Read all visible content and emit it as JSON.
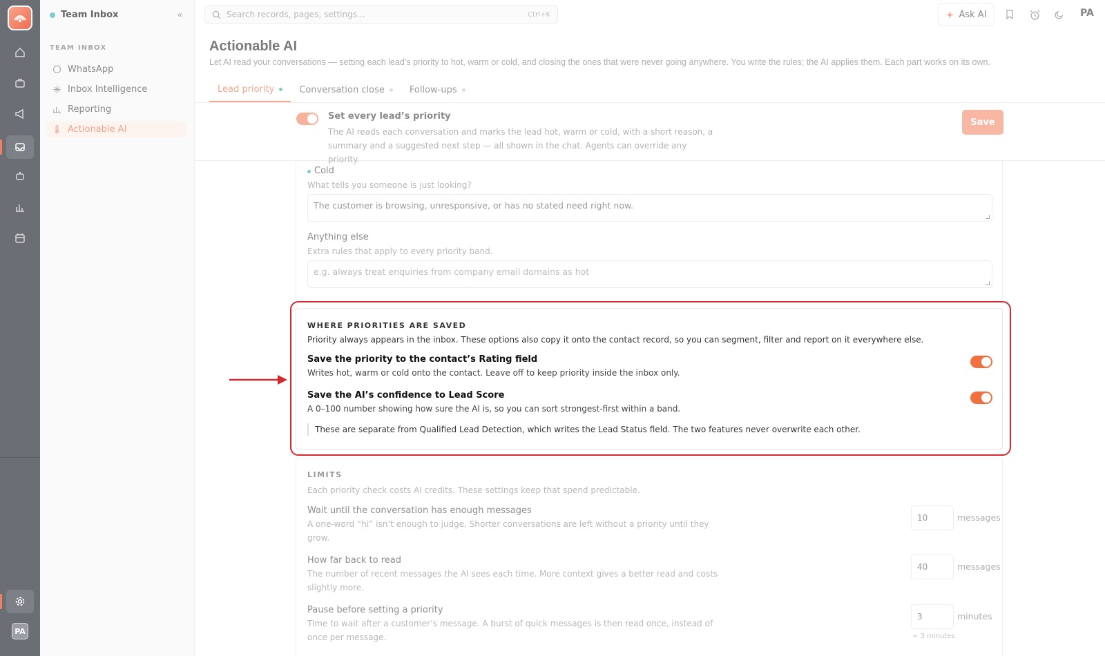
{
  "rail": {
    "avatar": "PA",
    "items": [
      "home-icon",
      "briefcase-icon",
      "megaphone-icon",
      "inbox-icon",
      "bot-icon",
      "chart-icon",
      "calendar-icon"
    ],
    "accent": "#f08060"
  },
  "sidebar": {
    "workspace": "Team Inbox",
    "section": "TEAM INBOX",
    "items": [
      {
        "label": "WhatsApp"
      },
      {
        "label": "Inbox Intelligence"
      },
      {
        "label": "Reporting"
      },
      {
        "label": "Actionable AI"
      }
    ]
  },
  "topbar": {
    "search_placeholder": "Search records, pages, settings...",
    "shortcut": "Ctrl+K",
    "ask_ai": "Ask AI",
    "user": "PA"
  },
  "page": {
    "title": "Actionable AI",
    "subtitle": "Let AI read your conversations — setting each lead’s priority to hot, warm or cold, and closing the ones that were never going anywhere. You write the rules; the AI applies them. Each part works on its own.",
    "tabs": [
      {
        "label": "Lead priority"
      },
      {
        "label": "Conversation close"
      },
      {
        "label": "Follow-ups"
      }
    ]
  },
  "master": {
    "title": "Set every lead’s priority",
    "desc": "The AI reads each conversation and marks the lead hot, warm or cold, with a short reason, a summary and a suggested next step — all shown in the chat. Agents can override any priority.",
    "save": "Save",
    "enabled": true
  },
  "cold": {
    "label": "Cold",
    "help": "What tells you someone is just looking?",
    "value": "The customer is browsing, unresponsive, or has no stated need right now."
  },
  "anything_else": {
    "label": "Anything else",
    "help": "Extra rules that apply to every priority band.",
    "placeholder": "e.g. always treat enquiries from company email domains as hot"
  },
  "saved": {
    "caption": "WHERE PRIORITIES ARE SAVED",
    "desc": "Priority always appears in the inbox. These options also copy it onto the contact record, so you can segment, filter and report on it everywhere else.",
    "rating": {
      "title": "Save the priority to the contact’s Rating field",
      "desc": "Writes hot, warm or cold onto the contact. Leave off to keep priority inside the inbox only.",
      "enabled": true
    },
    "score": {
      "title": "Save the AI’s confidence to Lead Score",
      "desc": "A 0–100 number showing how sure the AI is, so you can sort strongest-first within a band.",
      "enabled": true
    },
    "note": "These are separate from Qualified Lead Detection, which writes the Lead Status field. The two features never overwrite each other."
  },
  "limits": {
    "caption": "LIMITS",
    "desc": "Each priority check costs AI credits. These settings keep that spend predictable.",
    "rows": [
      {
        "title": "Wait until the conversation has enough messages",
        "desc1": "A one-word “hi” isn’t enough to judge. Shorter conversations are left without a priority until they",
        "desc2": "grow.",
        "value": "10",
        "unit": "messages"
      },
      {
        "title": "How far back to read",
        "desc1": "The number of recent messages the AI sees each time. More context gives a better read and costs",
        "desc2": "slightly more.",
        "value": "40",
        "unit": "messages"
      },
      {
        "title": "Pause before setting a priority",
        "desc1": "Time to wait after a customer’s message. A burst of quick messages is then read once, instead of",
        "desc2": "once per message.",
        "value": "3",
        "unit": "minutes",
        "hint": "= 3 minutes"
      }
    ]
  },
  "colors": {
    "brand": "#f0703f",
    "highlight": "#d7262e"
  }
}
